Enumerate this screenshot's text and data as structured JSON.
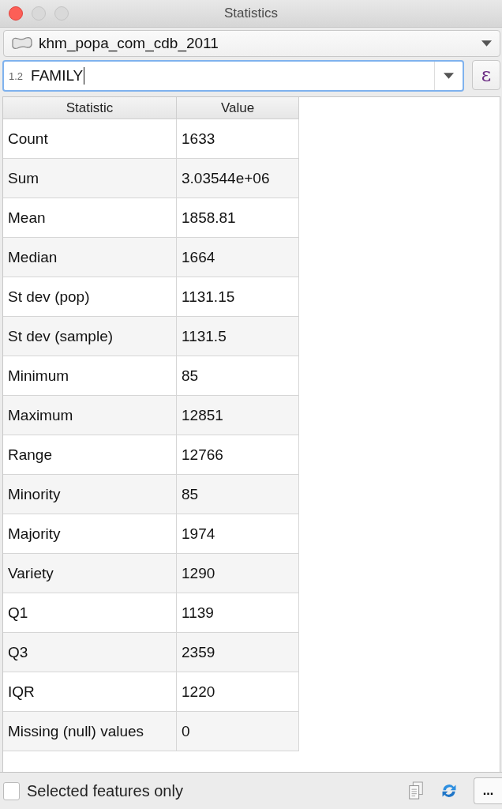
{
  "window": {
    "title": "Statistics"
  },
  "layer_selector": {
    "value": "khm_popa_com_cdb_2011"
  },
  "field_selector": {
    "type_label": "1.2",
    "value": "FAMILY",
    "expression_button": "ε"
  },
  "table": {
    "columns": [
      "Statistic",
      "Value"
    ],
    "rows": [
      {
        "statistic": "Count",
        "value": "1633"
      },
      {
        "statistic": "Sum",
        "value": "3.03544e+06"
      },
      {
        "statistic": "Mean",
        "value": "1858.81"
      },
      {
        "statistic": "Median",
        "value": "1664"
      },
      {
        "statistic": "St dev (pop)",
        "value": "1131.15"
      },
      {
        "statistic": "St dev (sample)",
        "value": "1131.5"
      },
      {
        "statistic": "Minimum",
        "value": "85"
      },
      {
        "statistic": "Maximum",
        "value": "12851"
      },
      {
        "statistic": "Range",
        "value": "12766"
      },
      {
        "statistic": "Minority",
        "value": "85"
      },
      {
        "statistic": "Majority",
        "value": "1974"
      },
      {
        "statistic": "Variety",
        "value": "1290"
      },
      {
        "statistic": "Q1",
        "value": "1139"
      },
      {
        "statistic": "Q3",
        "value": "2359"
      },
      {
        "statistic": "IQR",
        "value": "1220"
      },
      {
        "statistic": "Missing (null) values",
        "value": "0"
      }
    ]
  },
  "footer": {
    "selected_only": {
      "label": "Selected features only",
      "checked": false
    },
    "more_button": "..."
  }
}
